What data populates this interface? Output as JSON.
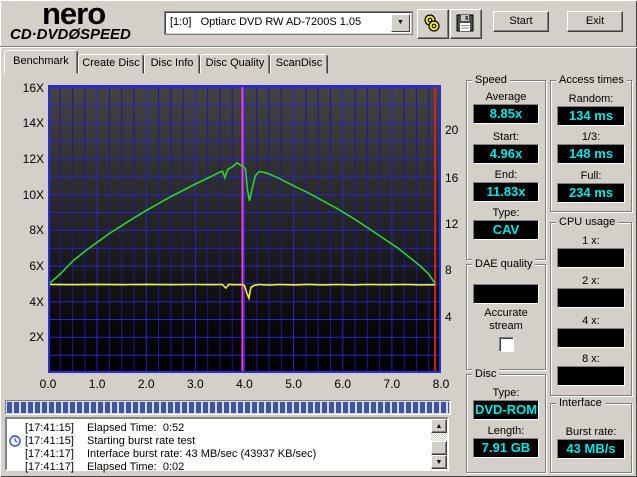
{
  "header": {
    "logo": {
      "name": "nero",
      "product_left": "CD·DVD",
      "disc_glyph": "Ø",
      "product_right": "SPEED"
    },
    "drive_select": {
      "value": "[1:0]   Optiarc DVD RW AD-7200S 1.05"
    },
    "toolbar": {
      "start_label": "Start",
      "exit_label": "Exit"
    }
  },
  "tabs": [
    {
      "label": "Benchmark",
      "active": true
    },
    {
      "label": "Create Disc",
      "active": false
    },
    {
      "label": "Disc Info",
      "active": false
    },
    {
      "label": "Disc Quality",
      "active": false
    },
    {
      "label": "ScanDisc",
      "active": false
    }
  ],
  "panels": {
    "speed": {
      "title": "Speed",
      "fields": [
        {
          "label": "Average",
          "value": "8.85x"
        },
        {
          "label": "Start:",
          "value": "4.96x"
        },
        {
          "label": "End:",
          "value": "11.83x"
        },
        {
          "label": "Type:",
          "value": "CAV"
        }
      ]
    },
    "access_times": {
      "title": "Access times",
      "fields": [
        {
          "label": "Random:",
          "value": "134 ms"
        },
        {
          "label": "1/3:",
          "value": "148 ms"
        },
        {
          "label": "Full:",
          "value": "234 ms"
        }
      ]
    },
    "dae_quality": {
      "title": "DAE quality",
      "display_value": "",
      "checkbox_label_line1": "Accurate",
      "checkbox_label_line2": "stream",
      "checkbox_checked": false
    },
    "cpu_usage": {
      "title": "CPU usage",
      "fields": [
        {
          "label": "1 x:",
          "value": ""
        },
        {
          "label": "2 x:",
          "value": ""
        },
        {
          "label": "4 x:",
          "value": ""
        },
        {
          "label": "8 x:",
          "value": ""
        }
      ]
    },
    "disc": {
      "title": "Disc",
      "fields": [
        {
          "label": "Type:",
          "value": "DVD-ROM"
        },
        {
          "label": "Length:",
          "value": "7.91 GB"
        }
      ]
    },
    "interface": {
      "title": "Interface",
      "fields": [
        {
          "label": "Burst rate:",
          "value": "43 MB/s"
        }
      ]
    }
  },
  "log": {
    "progress_percent": 100,
    "rows": [
      {
        "icon": "",
        "time": "[17:41:15]",
        "message": "Elapsed Time:  0:52"
      },
      {
        "icon": "clock",
        "time": "[17:41:15]",
        "message": "Starting burst rate test"
      },
      {
        "icon": "",
        "time": "[17:41:17]",
        "message": "Interface burst rate: 43 MB/sec (43937 KB/sec)"
      },
      {
        "icon": "",
        "time": "[17:41:17]",
        "message": "Elapsed Time:  0:02"
      }
    ]
  },
  "colors": {
    "lcd_text": "#00e6e6",
    "window_bg": "#d4d0c8"
  },
  "chart_data": {
    "type": "line",
    "title": "",
    "xlabel": "",
    "ylabel": "",
    "x_range": [
      0,
      8
    ],
    "y_range": [
      0,
      16.15
    ],
    "grid": {
      "x_step": 0.25,
      "y_step": 1,
      "minor_color": "#1a1a9c",
      "major_color": "#2727cc",
      "border_color": "#2b2bd4"
    },
    "x_ticks": [
      {
        "label": "0.0",
        "x": 0
      },
      {
        "label": "1.0",
        "x": 1
      },
      {
        "label": "2.0",
        "x": 2
      },
      {
        "label": "3.0",
        "x": 3
      },
      {
        "label": "4.0",
        "x": 4
      },
      {
        "label": "5.0",
        "x": 5
      },
      {
        "label": "6.0",
        "x": 6
      },
      {
        "label": "7.0",
        "x": 7
      },
      {
        "label": "8.0",
        "x": 8
      }
    ],
    "left_ticks": [
      {
        "label": "16X",
        "y": 16
      },
      {
        "label": "14X",
        "y": 14
      },
      {
        "label": "12X",
        "y": 12
      },
      {
        "label": "10X",
        "y": 10
      },
      {
        "label": "8X",
        "y": 8
      },
      {
        "label": "6X",
        "y": 6
      },
      {
        "label": "4X",
        "y": 4
      },
      {
        "label": "2X",
        "y": 2
      }
    ],
    "right_ticks": [
      {
        "label": "20",
        "pos": 13.6
      },
      {
        "label": "16",
        "pos": 10.96
      },
      {
        "label": "12",
        "pos": 8.38
      },
      {
        "label": "8",
        "pos": 5.75
      },
      {
        "label": "4",
        "pos": 3.12
      }
    ],
    "vlines": [
      {
        "name": "layer-break-marker",
        "x": 3.96,
        "color": "#f53cf5"
      },
      {
        "name": "disc-end-marker",
        "x": 7.88,
        "color": "#d42222"
      }
    ],
    "series": [
      {
        "name": "read-speed",
        "color": "#2fd32f",
        "points": [
          [
            0,
            4.96
          ],
          [
            0.25,
            5.55
          ],
          [
            0.5,
            6.27
          ],
          [
            0.75,
            6.82
          ],
          [
            1.0,
            7.33
          ],
          [
            1.25,
            7.82
          ],
          [
            1.5,
            8.26
          ],
          [
            1.75,
            8.7
          ],
          [
            2.0,
            9.11
          ],
          [
            2.25,
            9.5
          ],
          [
            2.5,
            9.89
          ],
          [
            2.75,
            10.24
          ],
          [
            3.0,
            10.6
          ],
          [
            3.25,
            10.93
          ],
          [
            3.45,
            11.2
          ],
          [
            3.55,
            11.32
          ],
          [
            3.6,
            10.95
          ],
          [
            3.66,
            11.42
          ],
          [
            3.75,
            11.55
          ],
          [
            3.85,
            11.78
          ],
          [
            3.92,
            11.65
          ],
          [
            3.98,
            11.55
          ],
          [
            4.02,
            11.45
          ],
          [
            4.06,
            10.3
          ],
          [
            4.1,
            9.65
          ],
          [
            4.16,
            10.4
          ],
          [
            4.22,
            11.05
          ],
          [
            4.3,
            11.3
          ],
          [
            4.45,
            11.22
          ],
          [
            4.7,
            10.92
          ],
          [
            5.0,
            10.5
          ],
          [
            5.3,
            10.1
          ],
          [
            5.6,
            9.65
          ],
          [
            5.9,
            9.2
          ],
          [
            6.2,
            8.7
          ],
          [
            6.5,
            8.16
          ],
          [
            6.8,
            7.6
          ],
          [
            7.1,
            7.05
          ],
          [
            7.4,
            6.4
          ],
          [
            7.6,
            5.95
          ],
          [
            7.75,
            5.55
          ],
          [
            7.85,
            5.15
          ],
          [
            7.88,
            5.05
          ]
        ]
      },
      {
        "name": "rotation-speed",
        "color": "#f0f02a",
        "points": [
          [
            0,
            4.97
          ],
          [
            0.5,
            4.95
          ],
          [
            1.0,
            4.97
          ],
          [
            1.5,
            4.95
          ],
          [
            2.0,
            4.97
          ],
          [
            2.5,
            4.95
          ],
          [
            3.0,
            4.96
          ],
          [
            3.3,
            4.95
          ],
          [
            3.55,
            4.96
          ],
          [
            3.62,
            4.76
          ],
          [
            3.68,
            4.96
          ],
          [
            3.8,
            4.95
          ],
          [
            3.95,
            4.95
          ],
          [
            4.0,
            4.9
          ],
          [
            4.05,
            4.45
          ],
          [
            4.09,
            4.2
          ],
          [
            4.13,
            4.8
          ],
          [
            4.2,
            4.92
          ],
          [
            4.3,
            4.96
          ],
          [
            4.5,
            4.93
          ],
          [
            4.7,
            4.96
          ],
          [
            5.0,
            4.94
          ],
          [
            5.3,
            4.97
          ],
          [
            5.6,
            4.94
          ],
          [
            5.9,
            4.96
          ],
          [
            6.2,
            4.94
          ],
          [
            6.5,
            4.96
          ],
          [
            6.9,
            4.95
          ],
          [
            7.3,
            4.96
          ],
          [
            7.6,
            4.94
          ],
          [
            7.88,
            4.95
          ]
        ]
      }
    ]
  }
}
